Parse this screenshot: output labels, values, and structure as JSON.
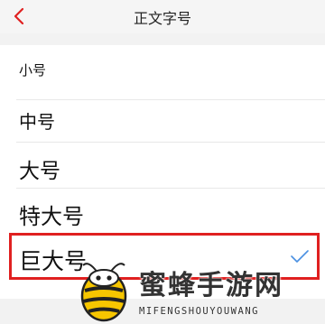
{
  "header": {
    "title": "正文字号"
  },
  "font_sizes": {
    "items": [
      {
        "label": "小号"
      },
      {
        "label": "中号"
      },
      {
        "label": "大号"
      },
      {
        "label": "特大号"
      },
      {
        "label": "巨大号",
        "selected": true
      }
    ]
  },
  "watermark": {
    "text_cn": "蜜蜂手游网",
    "text_en": "MIFENGSHOUYOUWANG"
  },
  "colors": {
    "accent_red": "#e02020",
    "check_blue": "#4a90e2",
    "bee_yellow": "#f7c600"
  }
}
